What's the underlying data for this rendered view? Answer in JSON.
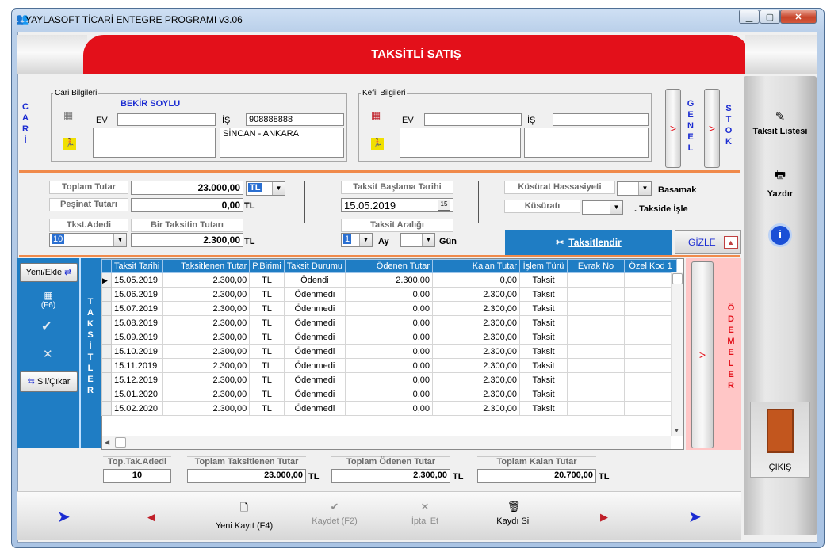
{
  "window": {
    "title": "YAYLASOFT TİCARİ ENTEGRE PROGRAMI v3.06",
    "icon": "people-icon"
  },
  "header": {
    "title": "TAKSİTLİ SATIŞ"
  },
  "side_letters": {
    "cari": "C A R İ",
    "genel": "G E N E L",
    "stok": "S T O K",
    "taksitler": "T A K S İ T L E R",
    "odemeler": "Ö D E M E L E R"
  },
  "cari": {
    "legend": "Cari Bilgileri",
    "name": "BEKİR SOYLU",
    "ev_label": "EV",
    "ev_value": "",
    "is_label": "İŞ",
    "is_value": "908888888",
    "address": "SİNCAN - ANKARA"
  },
  "kefil": {
    "legend": "Kefil Bilgileri",
    "ev_label": "EV",
    "is_label": "İŞ"
  },
  "summary": {
    "toplam_tutar_label": "Toplam Tutar",
    "toplam_tutar": "23.000,00",
    "currency": "TL",
    "pesinat_label": "Peşinat Tutarı",
    "pesinat": "0,00",
    "tkst_adedi_label": "Tkst.Adedi",
    "tkst_adedi": "10",
    "bir_taksit_label": "Bir Taksitin Tutarı",
    "bir_taksit": "2.300,00",
    "baslama_label": "Taksit Başlama Tarihi",
    "baslama": "15.05.2019",
    "aralik_label": "Taksit Aralığı",
    "aralik_ay": "1",
    "ay_label": "Ay",
    "gun_label": "Gün",
    "kusurat_hassasiyeti_label": "Küsürat Hassasiyeti",
    "basamak_label": "Basamak",
    "kusurati_label": "Küsüratı",
    "takside_isle_label": ". Takside İşle",
    "taksitlendir_label": "Taksitlendir",
    "gizle_label": "GİZLE"
  },
  "grid_buttons": {
    "yeni_ekle": "Yeni/Ekle",
    "f6": "(F6)",
    "sil_cikar": "Sil/Çıkar"
  },
  "table": {
    "columns": [
      "Taksit Tarihi",
      "Taksitlenen Tutar",
      "P.Birimi",
      "Taksit Durumu",
      "Ödenen Tutar",
      "Kalan Tutar",
      "İşlem Türü",
      "Evrak No",
      "Özel Kod 1"
    ],
    "rows": [
      [
        "15.05.2019",
        "2.300,00",
        "TL",
        "Ödendi",
        "2.300,00",
        "0,00",
        "Taksit",
        "",
        ""
      ],
      [
        "15.06.2019",
        "2.300,00",
        "TL",
        "Ödenmedi",
        "0,00",
        "2.300,00",
        "Taksit",
        "",
        ""
      ],
      [
        "15.07.2019",
        "2.300,00",
        "TL",
        "Ödenmedi",
        "0,00",
        "2.300,00",
        "Taksit",
        "",
        ""
      ],
      [
        "15.08.2019",
        "2.300,00",
        "TL",
        "Ödenmedi",
        "0,00",
        "2.300,00",
        "Taksit",
        "",
        ""
      ],
      [
        "15.09.2019",
        "2.300,00",
        "TL",
        "Ödenmedi",
        "0,00",
        "2.300,00",
        "Taksit",
        "",
        ""
      ],
      [
        "15.10.2019",
        "2.300,00",
        "TL",
        "Ödenmedi",
        "0,00",
        "2.300,00",
        "Taksit",
        "",
        ""
      ],
      [
        "15.11.2019",
        "2.300,00",
        "TL",
        "Ödenmedi",
        "0,00",
        "2.300,00",
        "Taksit",
        "",
        ""
      ],
      [
        "15.12.2019",
        "2.300,00",
        "TL",
        "Ödenmedi",
        "0,00",
        "2.300,00",
        "Taksit",
        "",
        ""
      ],
      [
        "15.01.2020",
        "2.300,00",
        "TL",
        "Ödenmedi",
        "0,00",
        "2.300,00",
        "Taksit",
        "",
        ""
      ],
      [
        "15.02.2020",
        "2.300,00",
        "TL",
        "Ödenmedi",
        "0,00",
        "2.300,00",
        "Taksit",
        "",
        ""
      ]
    ]
  },
  "totals": {
    "adet_label": "Top.Tak.Adedi",
    "adet": "10",
    "taksitlenen_label": "Toplam Taksitlenen Tutar",
    "taksitlenen": "23.000,00",
    "odenen_label": "Toplam Ödenen Tutar",
    "odenen": "2.300,00",
    "kalan_label": "Toplam Kalan Tutar",
    "kalan": "20.700,00",
    "currency": "TL"
  },
  "bottom": {
    "yeni_kayit": "Yeni Kayıt (F4)",
    "kaydet": "Kaydet (F2)",
    "iptal_et": "İptal Et",
    "kaydi_sil": "Kaydı Sil"
  },
  "right_panel": {
    "taksit_listesi": "Taksit Listesi",
    "yazdir": "Yazdır",
    "cikis": "ÇIKIŞ"
  },
  "colors": {
    "accent_red": "#e3101a",
    "grid_blue": "#1f7dc4",
    "divider_orange": "#f08a4b",
    "odemeler_pink": "#ffc6c6"
  }
}
